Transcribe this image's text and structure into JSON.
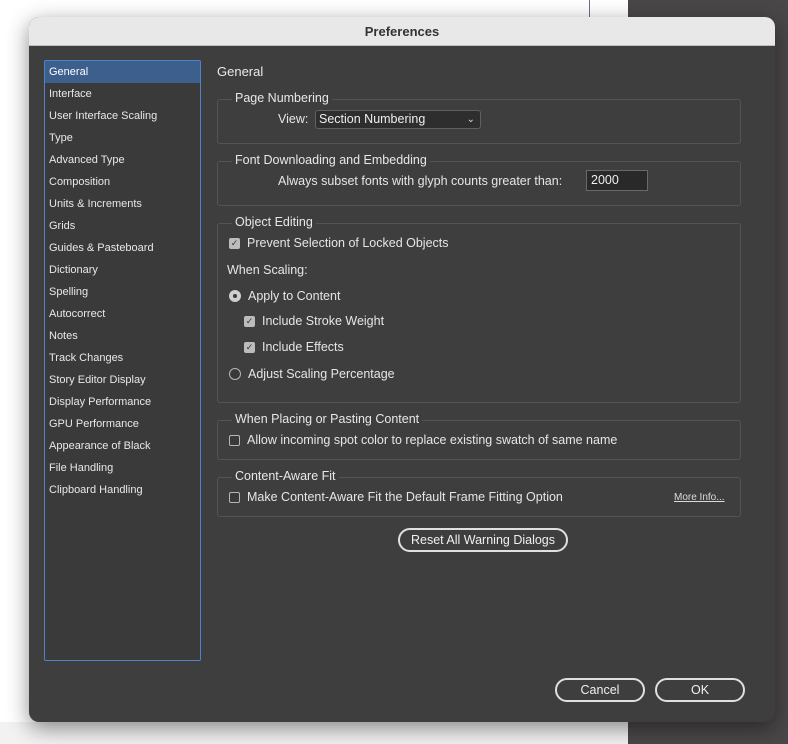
{
  "window": {
    "title": "Preferences"
  },
  "sidebar": {
    "items": [
      {
        "label": "General",
        "selected": true
      },
      {
        "label": "Interface"
      },
      {
        "label": "User Interface Scaling"
      },
      {
        "label": "Type"
      },
      {
        "label": "Advanced Type"
      },
      {
        "label": "Composition"
      },
      {
        "label": "Units & Increments"
      },
      {
        "label": "Grids"
      },
      {
        "label": "Guides & Pasteboard"
      },
      {
        "label": "Dictionary"
      },
      {
        "label": "Spelling"
      },
      {
        "label": "Autocorrect"
      },
      {
        "label": "Notes"
      },
      {
        "label": "Track Changes"
      },
      {
        "label": "Story Editor Display"
      },
      {
        "label": "Display Performance"
      },
      {
        "label": "GPU Performance"
      },
      {
        "label": "Appearance of Black"
      },
      {
        "label": "File Handling"
      },
      {
        "label": "Clipboard Handling"
      }
    ]
  },
  "main": {
    "title": "General",
    "page_numbering": {
      "title": "Page Numbering",
      "view_label": "View:",
      "view_value": "Section Numbering"
    },
    "font_downloading": {
      "title": "Font Downloading and Embedding",
      "subset_label": "Always subset fonts with glyph counts greater than:",
      "subset_value": "2000"
    },
    "object_editing": {
      "title": "Object Editing",
      "prevent_selection_label": "Prevent Selection of Locked Objects",
      "prevent_selection_checked": true,
      "when_scaling_label": "When Scaling:",
      "apply_to_content_label": "Apply to Content",
      "apply_to_content_selected": true,
      "include_stroke_label": "Include Stroke Weight",
      "include_stroke_checked": true,
      "include_effects_label": "Include Effects",
      "include_effects_checked": true,
      "adjust_scaling_label": "Adjust Scaling Percentage",
      "adjust_scaling_selected": false
    },
    "placing": {
      "title": "When Placing or Pasting Content",
      "allow_spot_label": "Allow incoming spot color to replace existing swatch of same name",
      "allow_spot_checked": false
    },
    "content_aware": {
      "title": "Content-Aware Fit",
      "default_label": "Make Content-Aware Fit the Default Frame Fitting Option",
      "default_checked": false,
      "more_info": "More Info..."
    },
    "reset_warnings_label": "Reset All Warning Dialogs"
  },
  "footer": {
    "cancel_label": "Cancel",
    "ok_label": "OK"
  },
  "icons": {
    "check": "checkmark-icon",
    "chevron": "chevron-down-icon"
  },
  "colors": {
    "dialog_bg": "#3f3e3f",
    "selection": "#3c5f8e",
    "sidebar_border": "#4e82c9"
  }
}
